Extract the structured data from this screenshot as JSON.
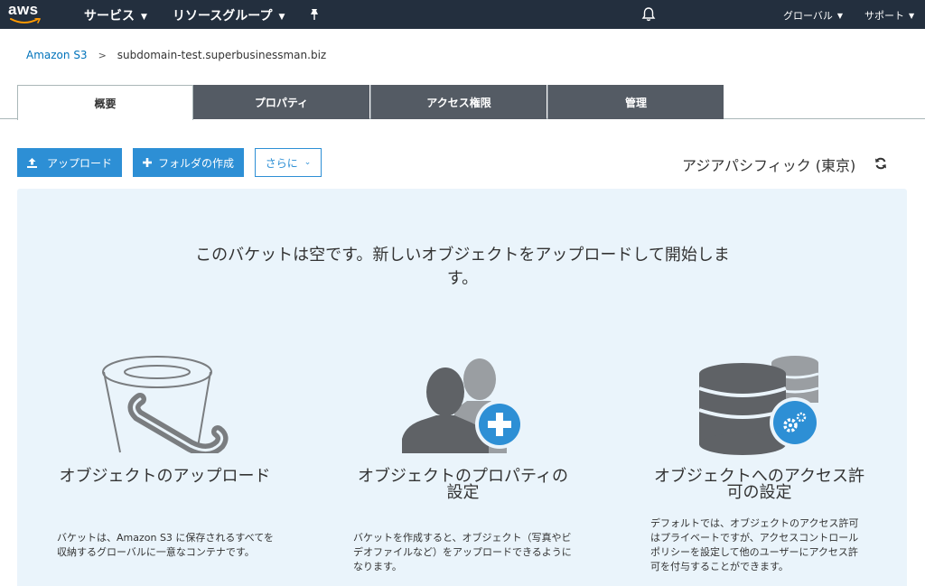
{
  "topnav": {
    "logo": "aws",
    "services": "サービス",
    "resource_groups": "リソースグループ",
    "region_menu": "グローバル",
    "support_menu": "サポート"
  },
  "breadcrumb": {
    "root": "Amazon S3",
    "current": "subdomain-test.superbusinessman.biz"
  },
  "tabs": [
    {
      "label": "概要",
      "active": true
    },
    {
      "label": "プロパティ",
      "active": false
    },
    {
      "label": "アクセス権限",
      "active": false
    },
    {
      "label": "管理",
      "active": false
    }
  ],
  "toolbar": {
    "upload": "アップロード",
    "create_folder": "フォルダの作成",
    "more": "さらに",
    "region": "アジアパシフィック (東京)"
  },
  "empty_state": {
    "message": "このバケットは空です。新しいオブジェクトをアップロードして開始します。"
  },
  "cards": [
    {
      "icon": "bucket-icon",
      "title": "オブジェクトのアップロード",
      "description": "バケットは、Amazon S3 に保存されるすべてを収納するグローバルに一意なコンテナです。"
    },
    {
      "icon": "users-add-icon",
      "title": "オブジェクトのプロパティの設定",
      "description": "バケットを作成すると、オブジェクト（写真やビデオファイルなど）をアップロードできるようになります。"
    },
    {
      "icon": "database-settings-icon",
      "title": "オブジェクトへのアクセス許可の設定",
      "description": "デフォルトでは、オブジェクトのアクセス許可はプライベートですが、アクセスコントロールポリシーを設定して他のユーザーにアクセス許可を付与することができます。"
    }
  ],
  "colors": {
    "nav_bg": "#232f3e",
    "accent": "#2d8fd5",
    "tab_inactive": "#545b64",
    "panel_bg": "#eaf4fb",
    "link": "#0073bb"
  }
}
